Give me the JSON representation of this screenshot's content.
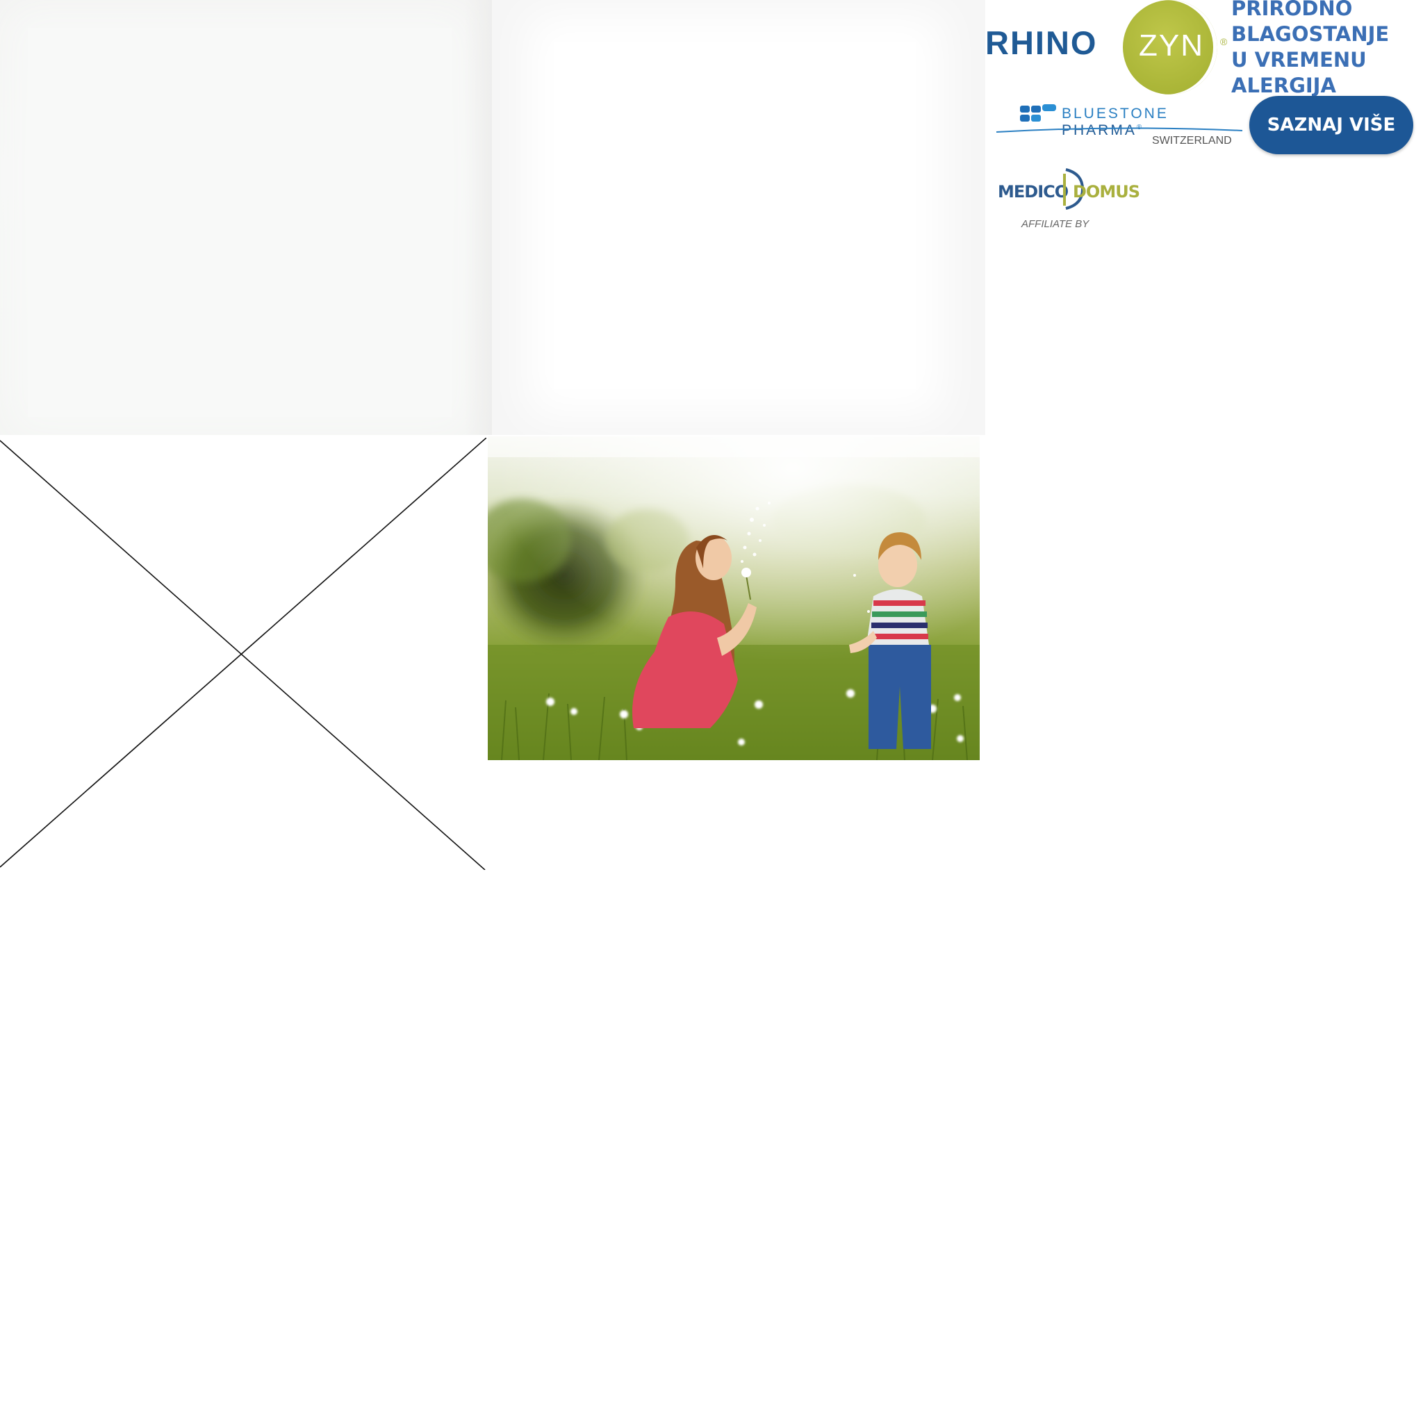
{
  "brand": {
    "name_left": "RHINO",
    "name_right": "ZYN",
    "registered_mark": "®",
    "tagline": [
      "PRIRODNO",
      "BLAGOSTANJE",
      "U VREMENU",
      "ALERGIJA"
    ],
    "cta_label": "SAZNAJ VIŠE"
  },
  "bluestone": {
    "name_part1": "BLUESTONE",
    "name_part2": "PHARMA",
    "registered_mark": "®",
    "country": "SWITZERLAND"
  },
  "medico": {
    "left": "MEDICO",
    "right": "DOMUS",
    "affiliate": "AFFILIATE BY"
  },
  "colors": {
    "brand_blue": "#1f5a95",
    "tagline_blue": "#3b6fb5",
    "zyn_green": "#aab537",
    "cta_bg": "#1d5796"
  },
  "images": {
    "broken_image_icon": "broken-image-x",
    "photo_subject": "mother-and-child-dandelion-photo"
  }
}
